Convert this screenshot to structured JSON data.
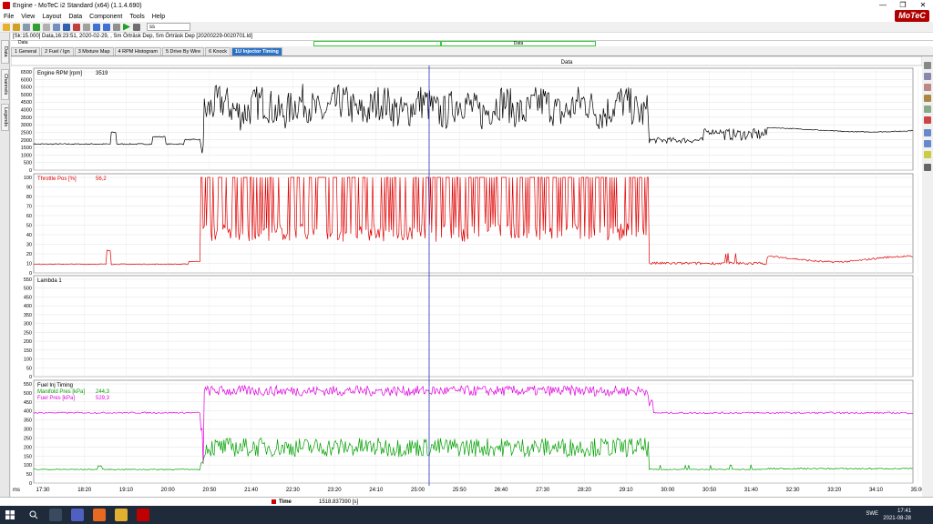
{
  "window": {
    "title": "Engine - MoTeC i2 Standard (x64) (1.1.4.690)",
    "min": "—",
    "max": "❐",
    "close": "✕"
  },
  "menu": [
    "File",
    "View",
    "Layout",
    "Data",
    "Component",
    "Tools",
    "Help"
  ],
  "logo": "MoTeC",
  "toolbar": {
    "select_value": "ss"
  },
  "file_line": "[Sk:15.000] Data,16:23:51, 2020-02-29, , Sm Örträsk Dep, Sm Örträsk Dep [20200229-0020701.ld]",
  "range_bar": {
    "label": "Data",
    "segment_label": "Data"
  },
  "tabs": [
    {
      "label": "1 General"
    },
    {
      "label": "2 Fuel / Ign"
    },
    {
      "label": "3 Mixture Map"
    },
    {
      "label": "4 RPM Histogram"
    },
    {
      "label": "5 Drive By Wire"
    },
    {
      "label": "6 Knock"
    },
    {
      "label": "1U Injector Timing"
    }
  ],
  "left_tabs": [
    "Data",
    "Channels",
    "Legends"
  ],
  "plot_header": "Data",
  "panels": [
    {
      "name": "Engine RPM [rpm]",
      "value": "3519",
      "color": "#000000",
      "ticks": [
        "6500",
        "6000",
        "5500",
        "5000",
        "4500",
        "4000",
        "3500",
        "3000",
        "2500",
        "2000",
        "1500",
        "1000",
        "500",
        "0"
      ]
    },
    {
      "name": "Throttle Pos [%]",
      "value": "56,2",
      "color": "#e00000",
      "ticks": [
        "100",
        "90",
        "80",
        "70",
        "60",
        "50",
        "40",
        "30",
        "20",
        "10",
        "0"
      ]
    },
    {
      "name": "Lambda 1",
      "value": "",
      "color": "#000000",
      "ticks": [
        "550",
        "500",
        "450",
        "400",
        "350",
        "300",
        "250",
        "200",
        "150",
        "100",
        "50",
        "0"
      ]
    },
    {
      "name": "Fuel Inj Timing",
      "value": "",
      "color": "#000000",
      "ticks": [
        "550",
        "500",
        "450",
        "400",
        "350",
        "300",
        "250",
        "200",
        "150",
        "100",
        "50",
        "0"
      ],
      "sub": [
        {
          "name": "Manifold Pres [kPa]",
          "value": "244,3",
          "color": "#00a000"
        },
        {
          "name": "Fuel Pres [kPa]",
          "value": "529,3",
          "color": "#e000e0"
        }
      ]
    }
  ],
  "x_unit": "ms",
  "x_ticks": [
    "17:30",
    "18:20",
    "19:10",
    "20:00",
    "20:50",
    "21:40",
    "22:30",
    "23:20",
    "24:10",
    "25:00",
    "25:50",
    "26:40",
    "27:30",
    "28:20",
    "29:10",
    "30:00",
    "30:50",
    "31:40",
    "32:30",
    "33:20",
    "34:10",
    "35:00"
  ],
  "status": {
    "label": "Time",
    "value": "1518.837390 [s]"
  },
  "taskbar": {
    "lang": "SWE",
    "time": "17:41",
    "date": "2021-08-28"
  }
}
